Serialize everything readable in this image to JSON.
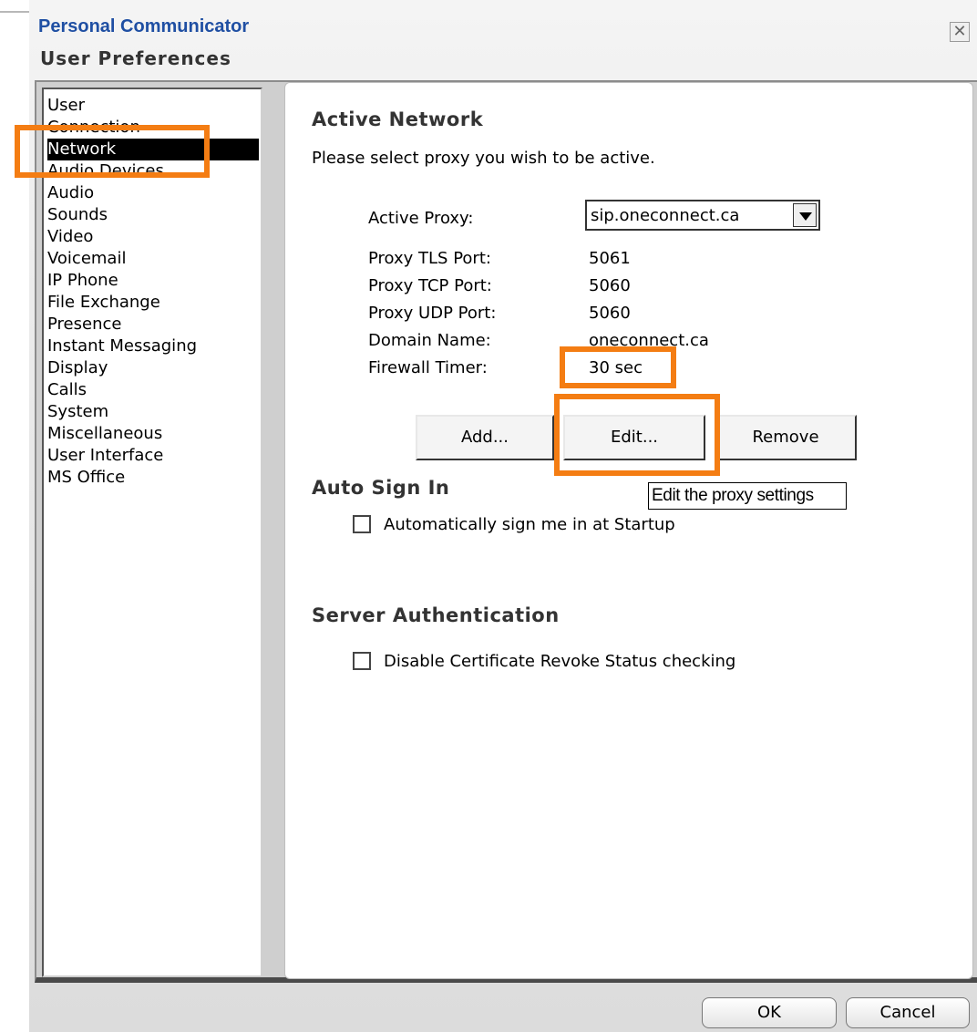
{
  "window": {
    "app_title": "Personal Communicator",
    "section_title": "User Preferences",
    "close_symbol": "✕"
  },
  "sidebar": {
    "items": [
      {
        "label": "User",
        "selected": false
      },
      {
        "label": "Connection",
        "selected": false
      },
      {
        "label": "Network",
        "selected": true
      },
      {
        "label": "Audio Devices",
        "selected": false
      },
      {
        "label": "Audio",
        "selected": false
      },
      {
        "label": "Sounds",
        "selected": false
      },
      {
        "label": "Video",
        "selected": false
      },
      {
        "label": "Voicemail",
        "selected": false
      },
      {
        "label": "IP Phone",
        "selected": false
      },
      {
        "label": "File Exchange",
        "selected": false
      },
      {
        "label": "Presence",
        "selected": false
      },
      {
        "label": "Instant Messaging",
        "selected": false
      },
      {
        "label": "Display",
        "selected": false
      },
      {
        "label": "Calls",
        "selected": false
      },
      {
        "label": "System",
        "selected": false
      },
      {
        "label": "Miscellaneous",
        "selected": false
      },
      {
        "label": "User Interface",
        "selected": false
      },
      {
        "label": "MS Office",
        "selected": false
      }
    ]
  },
  "active_network": {
    "heading": "Active Network",
    "description": "Please select proxy you wish to be active.",
    "active_proxy_label": "Active Proxy:",
    "active_proxy_value": "sip.oneconnect.ca",
    "fields": [
      {
        "label": "Proxy TLS Port:",
        "value": "5061"
      },
      {
        "label": "Proxy TCP Port:",
        "value": "5060"
      },
      {
        "label": "Proxy UDP Port:",
        "value": "5060"
      },
      {
        "label": "Domain Name:",
        "value": "oneconnect.ca"
      },
      {
        "label": "Firewall Timer:",
        "value": "30 sec"
      }
    ],
    "buttons": {
      "add": "Add...",
      "edit": "Edit...",
      "remove": "Remove"
    },
    "tooltip": "Edit the proxy settings"
  },
  "auto_sign_in": {
    "heading": "Auto Sign In",
    "checkbox_label": "Automatically sign me in at Startup",
    "checked": false
  },
  "server_auth": {
    "heading": "Server Authentication",
    "checkbox_label": "Disable Certificate Revoke Status checking",
    "checked": false
  },
  "footer": {
    "ok": "OK",
    "cancel": "Cancel"
  },
  "colors": {
    "highlight": "#f47d13",
    "title_blue": "#1f4fa3",
    "selected_bg": "#000000"
  }
}
